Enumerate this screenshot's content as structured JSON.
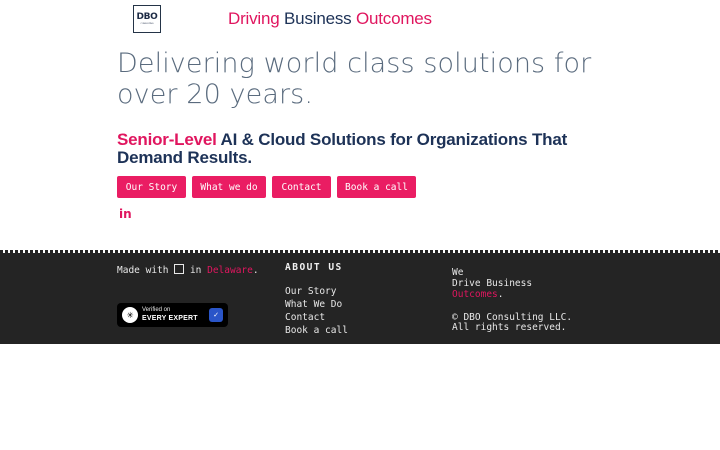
{
  "header": {
    "logo": {
      "mark": "DBO",
      "subtext": "CONSULTING"
    },
    "tagline": {
      "word1": "Driving",
      "word2": "Business",
      "word3": "Outcomes"
    }
  },
  "hero": {
    "headline": "Delivering world class solutions for over 20 years.",
    "subhead_highlight": "Senior-Level",
    "subhead_rest": " AI & Cloud Solutions for Organizations That Demand Results."
  },
  "buttons": [
    "Our Story",
    "What we do",
    "Contact",
    "Book a call"
  ],
  "social": {
    "icon": "linkedin-icon",
    "glyph": "in"
  },
  "footer": {
    "made_with_prefix": "Made with",
    "made_with_mid": " in ",
    "location": "Delaware",
    "period": ".",
    "badge": {
      "line1": "Verified on",
      "line2": "EVERY EXPERT",
      "star": "✳",
      "check": "✓"
    },
    "about_title": "ABOUT US",
    "about_links": [
      "Our Story",
      "What We Do",
      "Contact",
      "Book a call"
    ],
    "col3_line1": "We",
    "col3_line2": "Drive Business",
    "col3_line3": "Outcomes",
    "col3_period": ".",
    "copyright_line1": "© DBO Consulting LLC.",
    "copyright_line2": "All rights reserved."
  },
  "colors": {
    "accent": "#ea1d63",
    "navy": "#1d3257",
    "footer_bg": "#242424"
  }
}
